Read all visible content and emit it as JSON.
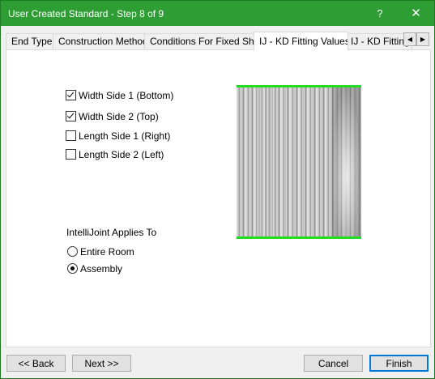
{
  "window": {
    "title": "User Created Standard - Step 8 of 9",
    "help_label": "?",
    "close_label": "✕"
  },
  "tabs": [
    {
      "label": "End Type"
    },
    {
      "label": "Construction Method"
    },
    {
      "label": "Conditions For Fixed Shelf"
    },
    {
      "label": "IJ - KD Fitting Values",
      "active": true
    },
    {
      "label": "IJ - KD Fitting"
    }
  ],
  "tab_scroll": {
    "left": "◀",
    "right": "▶"
  },
  "checkboxes": [
    {
      "label": "Width Side 1 (Bottom)",
      "checked": true
    },
    {
      "label": "Width Side 2 (Top)",
      "checked": true
    },
    {
      "label": "Length Side 1 (Right)",
      "checked": false
    },
    {
      "label": "Length Side 2 (Left)",
      "checked": false
    }
  ],
  "applies_to": {
    "label": "IntelliJoint Applies To",
    "options": [
      {
        "label": "Entire Room",
        "selected": false
      },
      {
        "label": "Assembly",
        "selected": true
      }
    ]
  },
  "preview": {
    "edge_color": "#22dd22"
  },
  "buttons": {
    "back": "<< Back",
    "next": "Next >>",
    "cancel": "Cancel",
    "finish": "Finish"
  },
  "colors": {
    "titlebar": "#2e9e34",
    "focus": "#0078d7"
  }
}
